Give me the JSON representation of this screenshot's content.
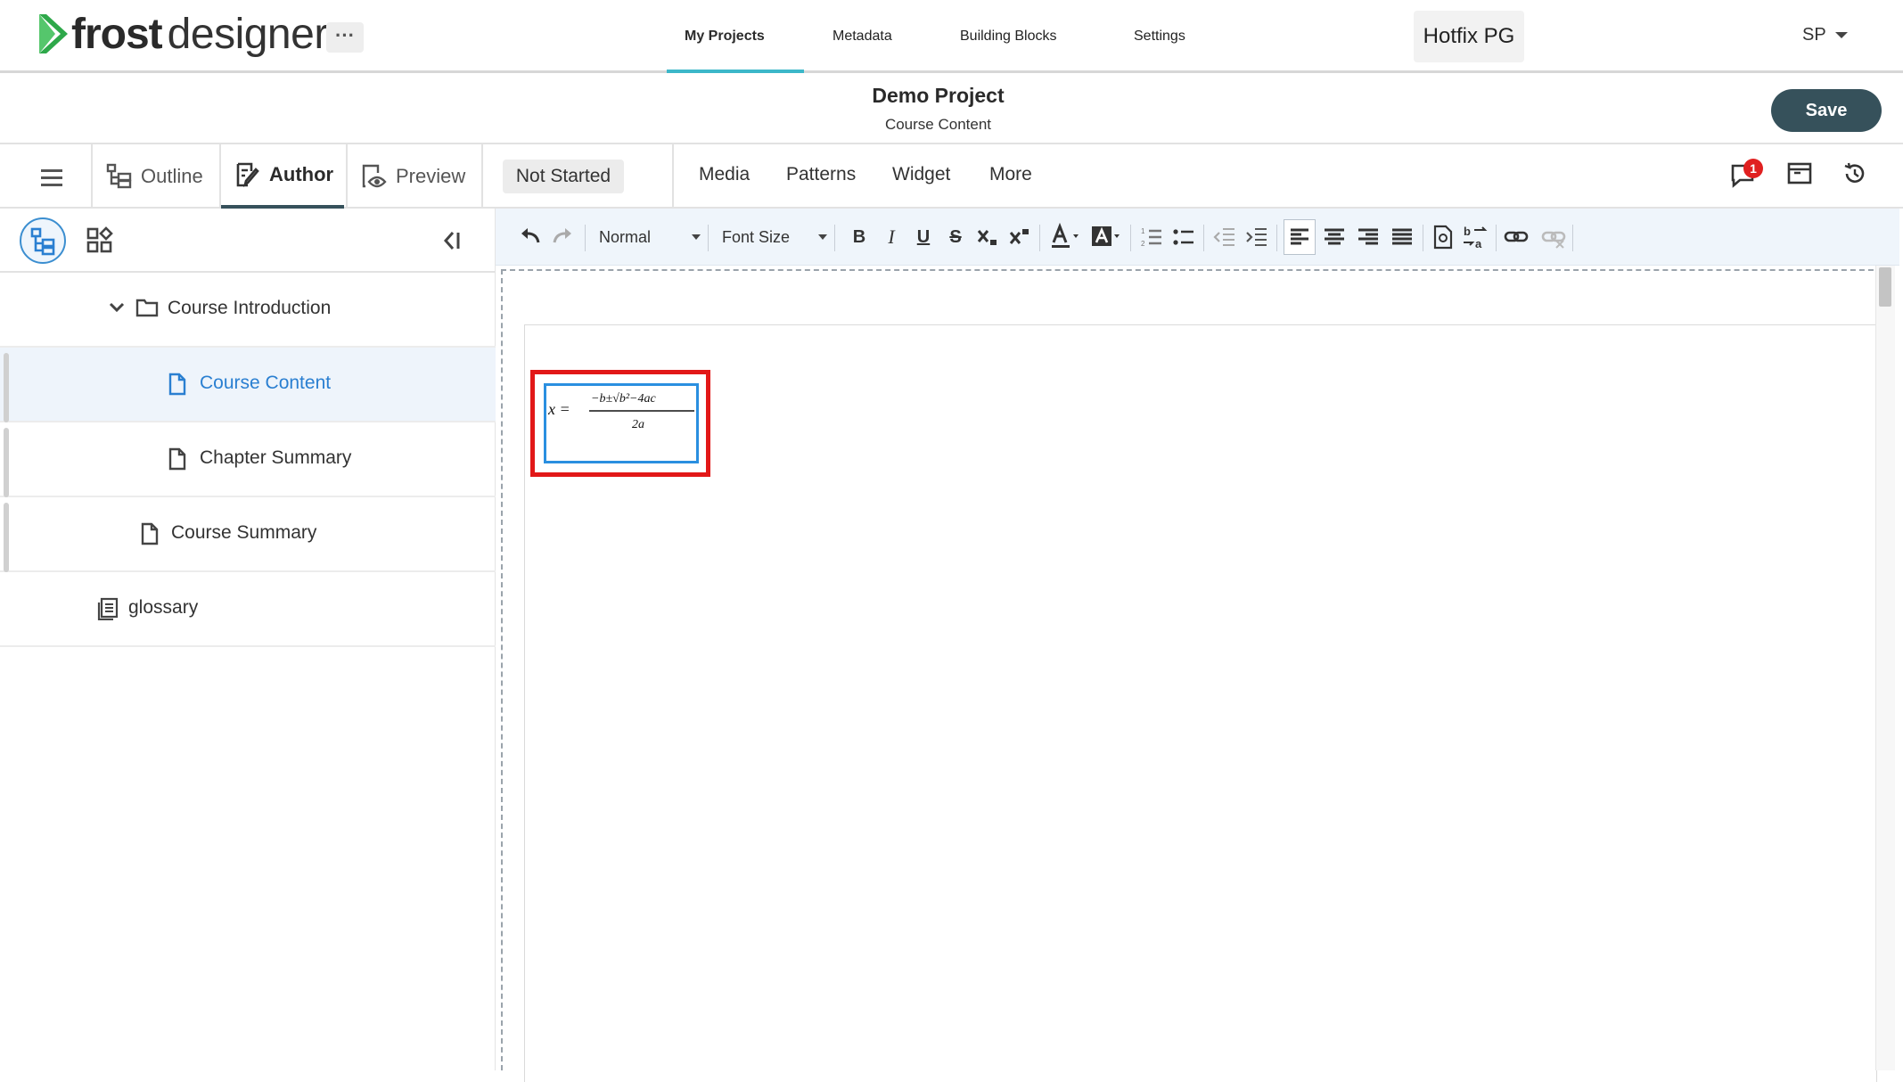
{
  "app": {
    "logo_bold": "frost",
    "logo_light": "designer",
    "more_label": "···"
  },
  "nav": {
    "items": [
      "My Projects",
      "Metadata",
      "Building Blocks",
      "Settings"
    ],
    "active": "My Projects",
    "accent_color": "#3cb7c9"
  },
  "workspace": {
    "label": "Hotfix PG"
  },
  "user": {
    "initials": "SP"
  },
  "project": {
    "title": "Demo Project",
    "subtitle": "Course Content",
    "save_label": "Save",
    "save_color": "#36515b"
  },
  "modes": {
    "outline": "Outline",
    "author": "Author",
    "preview": "Preview",
    "active": "Author",
    "status": "Not Started"
  },
  "menu": {
    "items": [
      "Media",
      "Patterns",
      "Widget",
      "More"
    ]
  },
  "notifications": {
    "count": "1",
    "badge_color": "#e02020"
  },
  "tree": {
    "items": [
      {
        "label": "Course Introduction",
        "icon": "folder-icon",
        "expanded": true
      },
      {
        "label": "Course Content",
        "icon": "page-icon",
        "selected": true
      },
      {
        "label": "Chapter Summary",
        "icon": "page-icon"
      },
      {
        "label": "Course Summary",
        "icon": "page-icon"
      },
      {
        "label": "glossary",
        "icon": "glossary-icon"
      }
    ]
  },
  "toolbar": {
    "format_select": "Normal",
    "font_size_select": "Font Size",
    "bold": "B",
    "italic": "I",
    "underline": "U",
    "strike": "S"
  },
  "equation": {
    "lhs": "x =",
    "numerator": "−b±√b²−4ac",
    "denominator": "2a",
    "highlight_color": "#e21818"
  }
}
